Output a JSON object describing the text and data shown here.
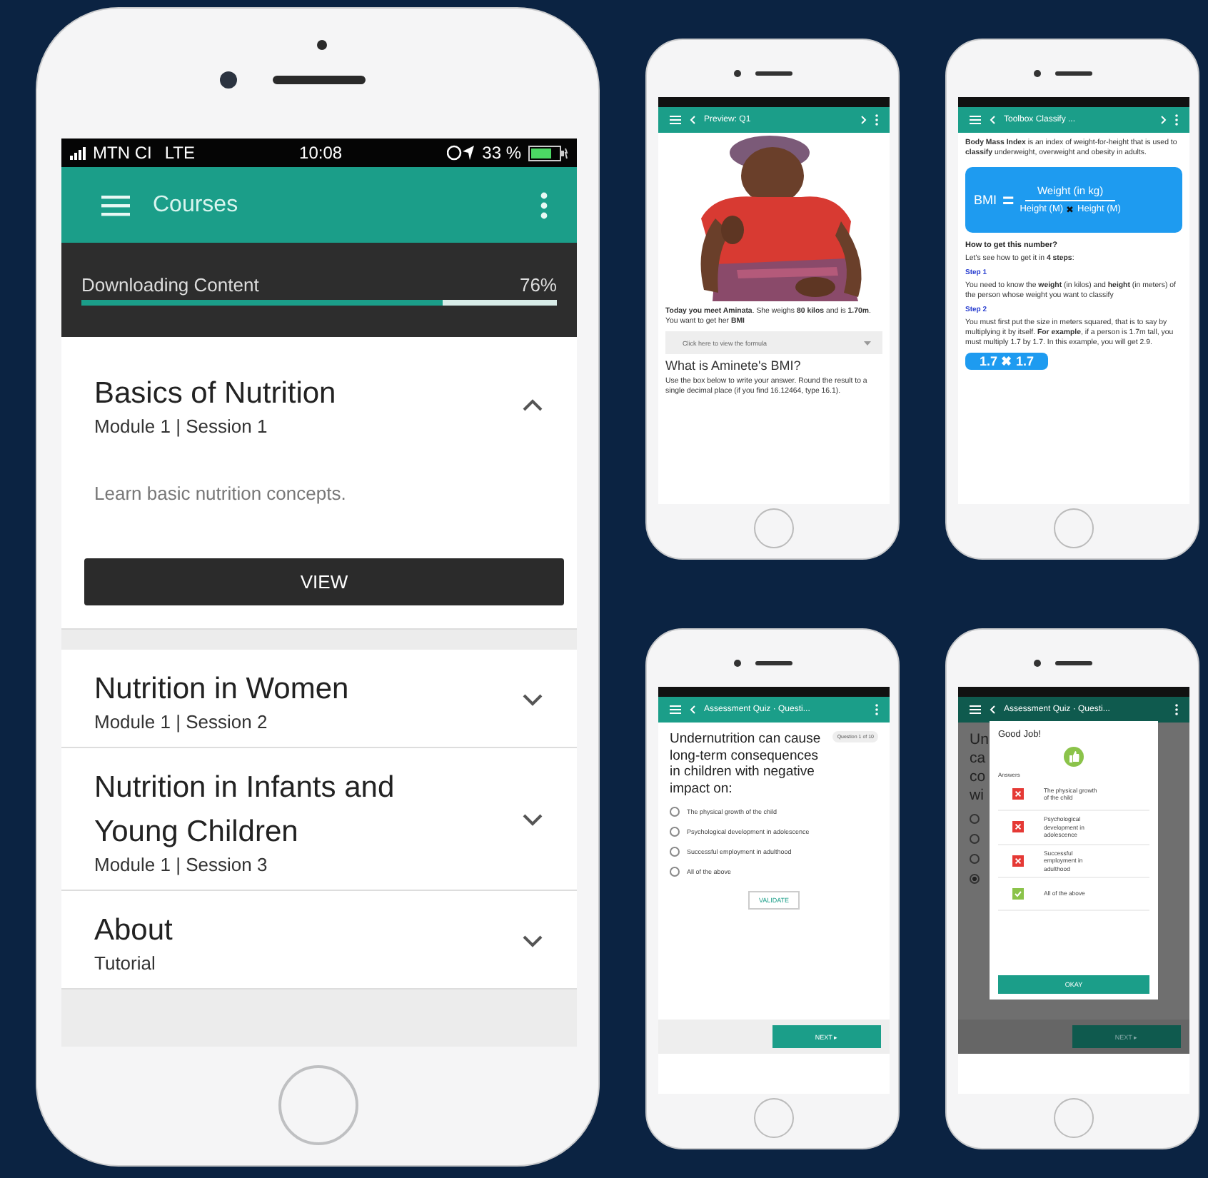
{
  "main_phone": {
    "status_bar": {
      "carrier": "MTN CI",
      "network": "LTE",
      "time": "10:08",
      "battery": "33 %"
    },
    "toolbar": {
      "title": "Courses"
    },
    "download": {
      "label": "Downloading Content",
      "percent": "76%",
      "level": 0.76
    },
    "courses": [
      {
        "title": "Basics of Nutrition",
        "subtitle": "Module 1 | Session 1",
        "expanded": true,
        "description": "Learn basic nutrition concepts.",
        "button": "VIEW"
      },
      {
        "title": "Nutrition in Women",
        "subtitle": "Module 1 | Session 2",
        "expanded": false
      },
      {
        "title": "Nutrition in Infants and Young Children",
        "subtitle": "Module 1 | Session 3",
        "expanded": false
      },
      {
        "title": "About",
        "subtitle": "Tutorial",
        "expanded": false
      }
    ]
  },
  "preview_phone": {
    "toolbar": {
      "title": "Preview: Q1"
    },
    "intro": "**Today you meet Aminata**. She weighs **80 kilos** and is **1.70m**. You want to get her **BMI**",
    "dropdown": "Click here to view the formula",
    "heading": "What is Aminete's BMI?",
    "instructions": "Use the box below to write your answer. Round the result to a single decimal place (if you find 16.12464, type 16.1)."
  },
  "toolbox_phone": {
    "toolbar": {
      "title": "Toolbox Classify ..."
    },
    "intro": "**Body Mass Index** is an index of weight-for-height that is used to **classify** underweight, overweight and obesity in adults.",
    "formula": {
      "left": "BMI",
      "equals": "=",
      "numerator": "Weight (in kg)",
      "factor_1": "Height (M)",
      "times": "✖",
      "factor_2": "Height (M)"
    },
    "question": "How to get this number?",
    "lead": "Let's see how to get it in **4 steps**:",
    "steps": [
      {
        "title": "Step 1",
        "text": "You need to know the **weight** (in kilos) and **height** (in meters) of the person whose weight you want to classify"
      },
      {
        "title": "Step 2",
        "text": "You must first put the size in meters squared, that is to say by multiplying it by itself. **For example**, if a person is 1.7m tall, you must multiply 1.7 by 1.7. In this example, you will get 2.9."
      }
    ],
    "example": "1.7 ✖ 1.7"
  },
  "quiz_phone": {
    "toolbar": {
      "title": "Assessment Quiz · Questi..."
    },
    "badge": "Question 1 of 10",
    "question": "Undernutrition can cause long-term consequences in children with negative impact on:",
    "options": [
      {
        "label": "The physical growth of the child",
        "selected": false
      },
      {
        "label": "Psychological development in adolescence",
        "selected": false
      },
      {
        "label": "Successful employment in adulthood",
        "selected": false
      },
      {
        "label": "All of the above",
        "selected": false
      }
    ],
    "validate": "VALIDATE",
    "next": "NEXT ▸"
  },
  "result_phone": {
    "toolbar": {
      "title": "Assessment Quiz · Questi..."
    },
    "question_fragments": [
      "Un",
      "ca",
      "co",
      "wi"
    ],
    "radios": [
      {
        "selected": false
      },
      {
        "selected": false
      },
      {
        "selected": false
      },
      {
        "selected": true
      }
    ],
    "next": "NEXT ▸",
    "dialog": {
      "title": "Good Job!",
      "answers_label": "Answers",
      "answers": [
        {
          "text": "The physical growth of the child",
          "correct": false
        },
        {
          "text": "Psychological development in adolescence",
          "correct": false
        },
        {
          "text": "Successful employment in adulthood",
          "correct": false
        },
        {
          "text": "All of the above",
          "correct": true
        }
      ],
      "button": "OKAY"
    }
  }
}
